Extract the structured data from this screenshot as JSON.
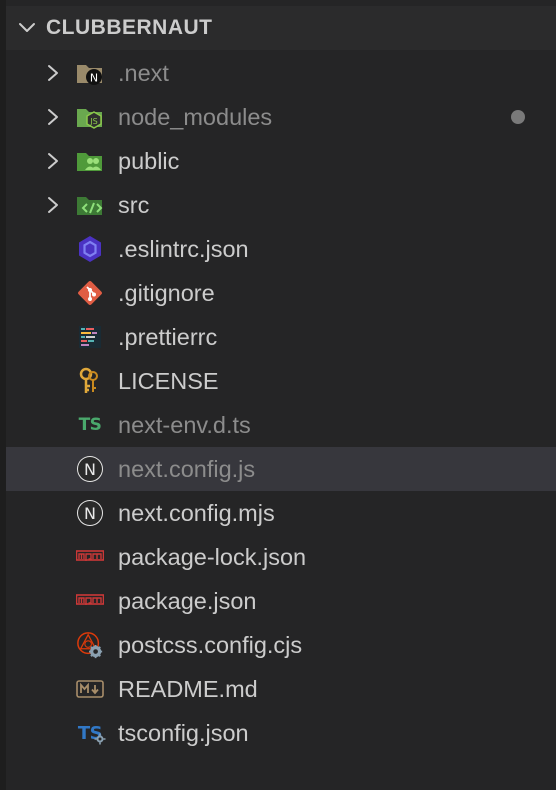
{
  "explorer": {
    "section_title": "CLUBBERNAUT",
    "items": [
      {
        "label": "next",
        "prefix": ".",
        "kind": "folder",
        "icon": "next-folder-icon",
        "dim": true,
        "badge": false
      },
      {
        "label": "node_modules",
        "prefix": "",
        "kind": "folder",
        "icon": "node-folder-icon",
        "dim": true,
        "badge": true
      },
      {
        "label": "public",
        "prefix": "",
        "kind": "folder",
        "icon": "public-folder-icon",
        "dim": false,
        "badge": false
      },
      {
        "label": "src",
        "prefix": "",
        "kind": "folder",
        "icon": "src-folder-icon",
        "dim": false,
        "badge": false
      },
      {
        "label": ".eslintrc.json",
        "kind": "file",
        "icon": "eslint-icon",
        "dim": false,
        "badge": false
      },
      {
        "label": ".gitignore",
        "kind": "file",
        "icon": "git-icon",
        "dim": false,
        "badge": false
      },
      {
        "label": ".prettierrc",
        "kind": "file",
        "icon": "prettier-icon",
        "dim": false,
        "badge": false
      },
      {
        "label": "LICENSE",
        "kind": "file",
        "icon": "license-key-icon",
        "dim": false,
        "badge": false
      },
      {
        "label": "next-env.d.ts",
        "kind": "file",
        "icon": "typescript-icon",
        "icon_text": "TS",
        "dim": true,
        "badge": false
      },
      {
        "label": "next.config.js",
        "kind": "file",
        "icon": "nextjs-icon",
        "icon_text": "N",
        "dim": true,
        "badge": false,
        "selected": true
      },
      {
        "label": "next.config.mjs",
        "kind": "file",
        "icon": "nextjs-icon",
        "icon_text": "N",
        "dim": false,
        "badge": false
      },
      {
        "label": "package-lock.json",
        "kind": "file",
        "icon": "npm-icon",
        "dim": false,
        "badge": false
      },
      {
        "label": "package.json",
        "kind": "file",
        "icon": "npm-icon",
        "dim": false,
        "badge": false
      },
      {
        "label": "postcss.config.cjs",
        "kind": "file",
        "icon": "postcss-icon",
        "dim": false,
        "badge": false
      },
      {
        "label": "README.md",
        "kind": "file",
        "icon": "markdown-icon",
        "icon_text": "M↓",
        "dim": false,
        "badge": false
      },
      {
        "label": "tsconfig.json",
        "kind": "file",
        "icon": "tsconfig-icon",
        "icon_text": "TS",
        "dim": false,
        "badge": false
      }
    ]
  },
  "colors": {
    "background": "#252526",
    "header_bg": "#2b2b2c",
    "selected_bg": "#37373d",
    "text": "#cccccc",
    "text_dim": "#8c8c8c",
    "badge_dot": "#7a7a7a"
  }
}
